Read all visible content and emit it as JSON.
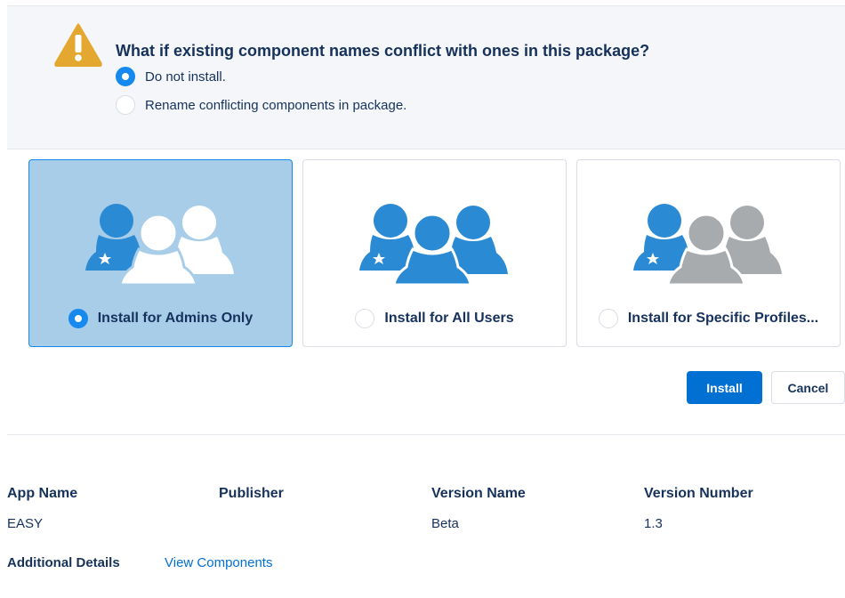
{
  "conflict": {
    "title": "What if existing component names conflict with ones in this package?",
    "options": [
      {
        "label": "Do not install.",
        "checked": true
      },
      {
        "label": "Rename conflicting components in package.",
        "checked": false
      }
    ],
    "icon": "warning-icon"
  },
  "install_options": [
    {
      "label": "Install for Admins Only",
      "selected": true,
      "icon": "admin-users-icon"
    },
    {
      "label": "Install for All Users",
      "selected": false,
      "icon": "all-users-icon"
    },
    {
      "label": "Install for Specific Profiles...",
      "selected": false,
      "icon": "specific-profiles-icon"
    }
  ],
  "buttons": {
    "install": "Install",
    "cancel": "Cancel"
  },
  "info": {
    "headers": [
      "App Name",
      "Publisher",
      "Version Name",
      "Version Number"
    ],
    "values": [
      "EASY",
      "",
      "Beta",
      "1.3"
    ]
  },
  "details": {
    "label": "Additional Details",
    "link": "View Components"
  },
  "colors": {
    "brand_blue": "#0070d2",
    "radio_blue": "#1589ee",
    "selected_card": "#a8cde9",
    "person_blue": "#2a8ad4",
    "person_grey": "#a8abae",
    "warning_yellow": "#e4a830"
  }
}
